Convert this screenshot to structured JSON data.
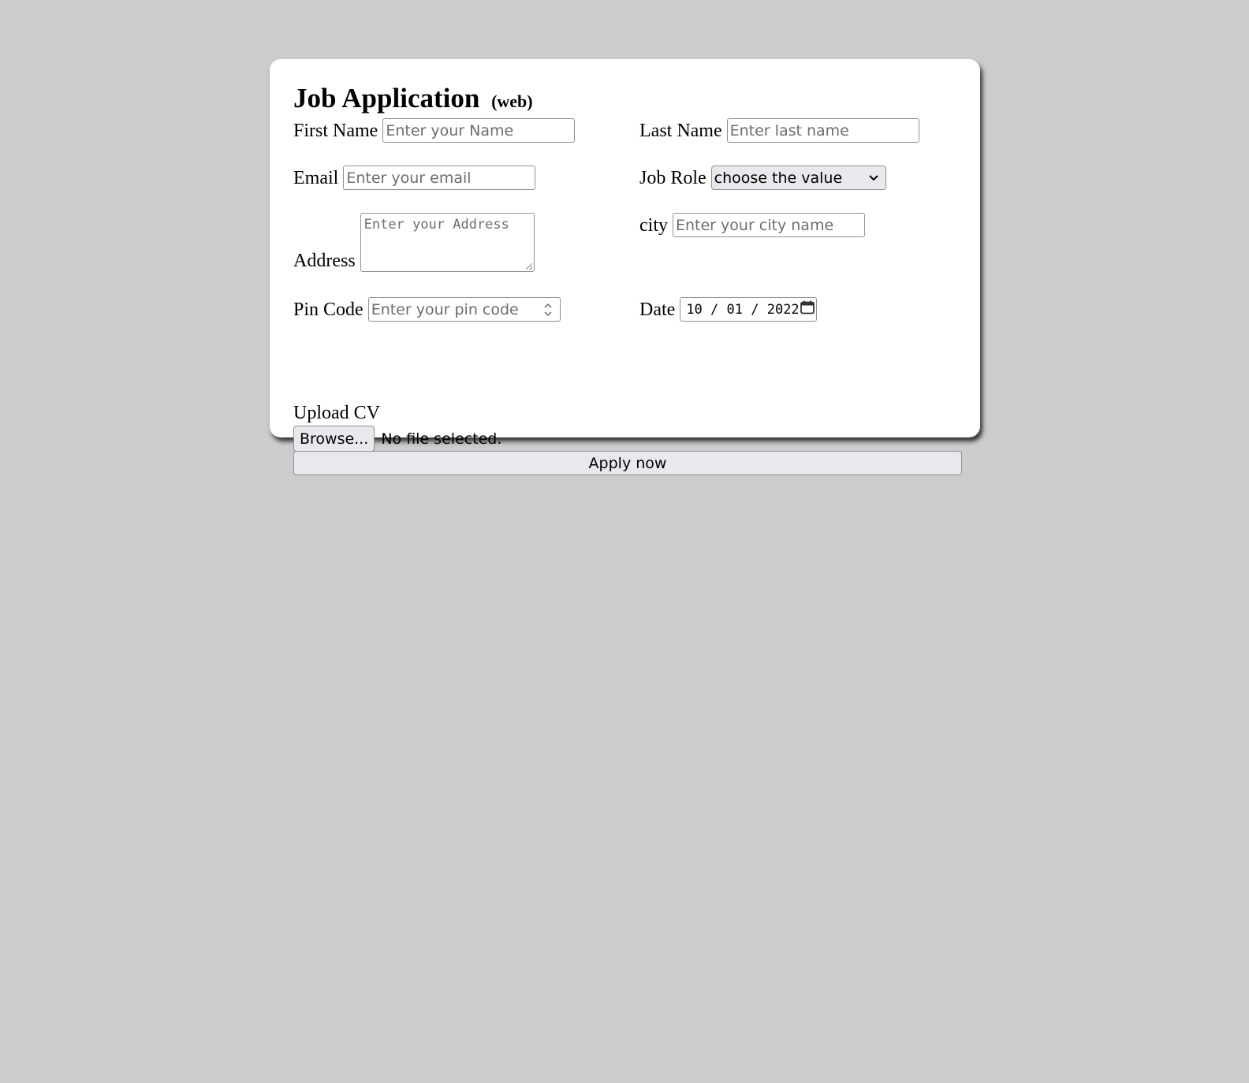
{
  "form": {
    "title": "Job Application",
    "title_suffix": "(web)",
    "first_name": {
      "label": "First Name",
      "placeholder": "Enter your Name"
    },
    "last_name": {
      "label": "Last Name",
      "placeholder": "Enter last name"
    },
    "email": {
      "label": "Email",
      "placeholder": "Enter your email"
    },
    "job_role": {
      "label": "Job Role",
      "selected": "choose the value"
    },
    "address": {
      "label": "Address",
      "placeholder": "Enter your Address"
    },
    "city": {
      "label": "city",
      "placeholder": "Enter your city name"
    },
    "pin_code": {
      "label": "Pin Code",
      "placeholder": "Enter your pin code"
    },
    "date": {
      "label": "Date",
      "day": "10",
      "month": "01",
      "year": "2022"
    },
    "upload": {
      "label": "Upload CV",
      "button": "Browse...",
      "status": "No file selected."
    },
    "submit_label": "Apply now"
  }
}
